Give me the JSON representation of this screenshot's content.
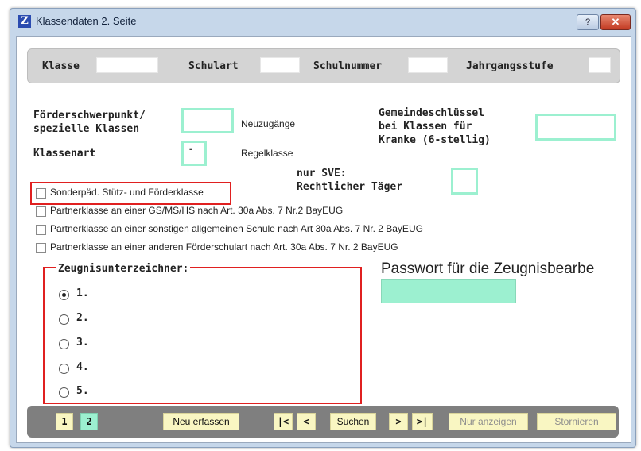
{
  "window": {
    "title": "Klassendaten 2. Seite",
    "help_label": "?",
    "close_label": "✕"
  },
  "header": {
    "klasse_label": "Klasse",
    "klasse_value": "",
    "schulart_label": "Schulart",
    "schulart_value": "",
    "schulnummer_label": "Schulnummer",
    "schulnummer_value": "",
    "jahrgangsstufe_label": "Jahrgangsstufe",
    "jahrgangsstufe_value": ""
  },
  "form": {
    "foerder_label_1": "Förderschwerpunkt/",
    "foerder_label_2": "spezielle Klassen",
    "foerder_value": "",
    "neuzugaenge": "Neuzugänge",
    "klassenart_label": "Klassenart",
    "klassenart_value": "-",
    "regelklasse": "Regelklasse",
    "gemeinde_label_1": "Gemeindeschlüssel",
    "gemeinde_label_2": "bei Klassen für",
    "gemeinde_label_3": "Kranke (6-stellig)",
    "gemeinde_value": "",
    "sve_label_1": "nur SVE:",
    "sve_label_2": "Rechtlicher Täger",
    "sve_value": ""
  },
  "checkboxes": [
    {
      "label": "Sonderpäd. Stütz- und Förderklasse",
      "checked": false
    },
    {
      "label": "Partnerklasse an einer GS/MS/HS nach Art. 30a Abs. 7 Nr.2 BayEUG",
      "checked": false
    },
    {
      "label": "Partnerklasse an einer sonstigen allgemeinen Schule nach Art 30a Abs. 7 Nr. 2 BayEUG",
      "checked": false
    },
    {
      "label": "Partnerklasse an einer anderen Förderschulart nach Art. 30a Abs. 7 Nr. 2 BayEUG",
      "checked": false
    }
  ],
  "zeugnis": {
    "title": "Zeugnisunterzeichner:",
    "options": [
      {
        "label": "1.",
        "name": "",
        "selected": true
      },
      {
        "label": "2.",
        "selected": false
      },
      {
        "label": "3.",
        "selected": false
      },
      {
        "label": "4.",
        "selected": false
      },
      {
        "label": "5.",
        "selected": false
      }
    ]
  },
  "passwort": {
    "label": "Passwort für die Zeugnisbearbe",
    "value": ""
  },
  "toolbar": {
    "page1": "1",
    "page2": "2",
    "neu_erfassen": "Neu erfassen",
    "first": "|<",
    "prev": "<",
    "suchen": "Suchen",
    "next": ">",
    "last": ">|",
    "nur_anzeigen": "Nur anzeigen",
    "stornieren": "Stornieren"
  },
  "colors": {
    "field_green": "#9cf0d0",
    "button_yellow": "#f9f6c2",
    "highlight_red": "#e02020",
    "toolbar_gray": "#7f7f7f"
  }
}
